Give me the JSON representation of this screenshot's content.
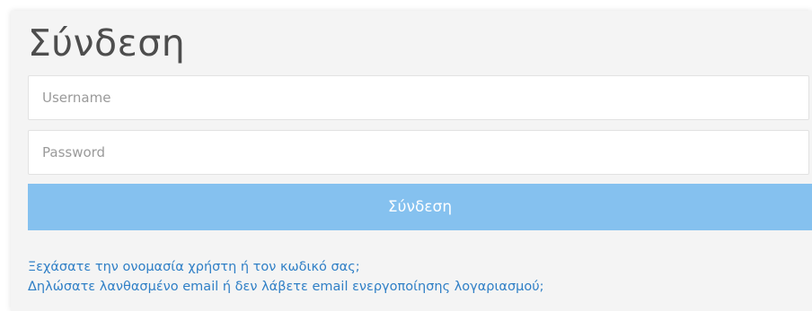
{
  "login": {
    "title": "Σύνδεση",
    "username_placeholder": "Username",
    "password_placeholder": "Password",
    "submit_label": "Σύνδεση",
    "forgot_link": "Ξεχάσατε την ονομασία χρήστη ή τον κωδικό σας;",
    "wrong_email_link": "Δηλώσατε λανθασμένο email ή δεν λάβετε email ενεργοποίησης λογαριασμού;"
  },
  "colors": {
    "button_bg": "#85c1ef",
    "link": "#2f7fc6",
    "title": "#4d4d4d",
    "panel_bg": "#f4f4f4"
  }
}
